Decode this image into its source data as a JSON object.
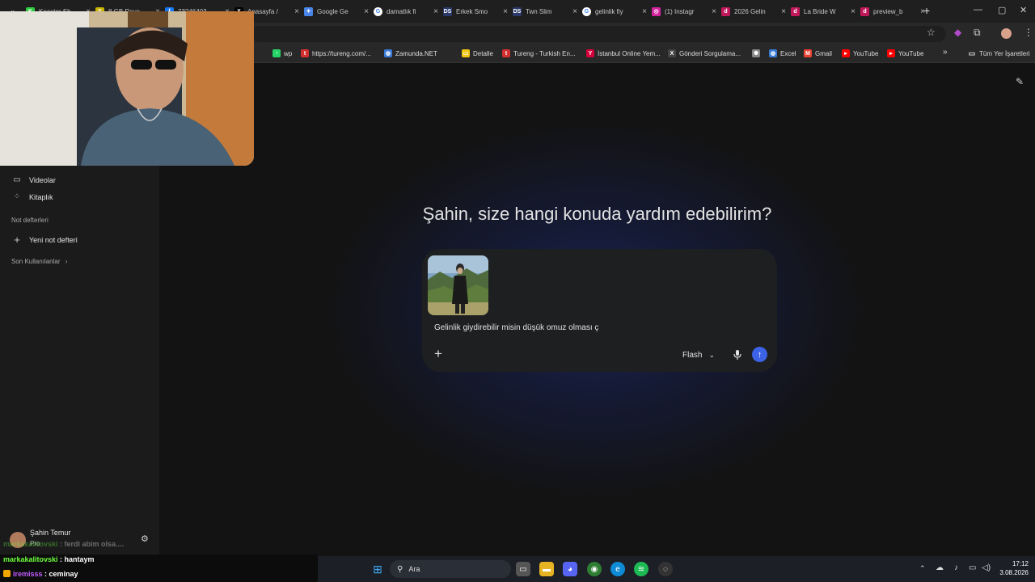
{
  "tabs": [
    {
      "title": "Keaxter Sh",
      "favicon": "K",
      "color": "#2ecc40"
    },
    {
      "title": "8 GB Reve",
      "favicon": "S",
      "color": "#c9b400"
    },
    {
      "title": "73246403",
      "favicon": "f",
      "color": "#1877f2"
    },
    {
      "title": "Anasayfa / ",
      "favicon": "X",
      "color": "#000000"
    },
    {
      "title": "Google Ge",
      "favicon": "✦",
      "color": "#4a86e8"
    },
    {
      "title": "damatlık fi",
      "favicon": "G",
      "color": "#ffffff"
    },
    {
      "title": "Erkek Smo",
      "favicon": "DS",
      "color": "#2b3a6b"
    },
    {
      "title": "Twn Slim ",
      "favicon": "DS",
      "color": "#2b3a6b"
    },
    {
      "title": "gelinlik fiy",
      "favicon": "G",
      "color": "#ffffff"
    },
    {
      "title": "(1) Instagr",
      "favicon": "◎",
      "color": "#d6249f"
    },
    {
      "title": "2026 Gelin",
      "favicon": "d",
      "color": "#c2185b"
    },
    {
      "title": "La Bride W",
      "favicon": "d",
      "color": "#c2185b"
    },
    {
      "title": "preview_b",
      "favicon": "d",
      "color": "#c2185b"
    }
  ],
  "bookmarks": [
    {
      "label": "wp",
      "icon": "whatsapp-icon",
      "color": "#25d366"
    },
    {
      "label": "https://tureng.com/...",
      "icon": "t",
      "color": "#d32f2f"
    },
    {
      "label": "Zamunda.NET",
      "icon": "globe",
      "color": "#3a7bd5"
    },
    {
      "label": "Detalle",
      "icon": "folder",
      "color": "#f1c40f"
    },
    {
      "label": "Tureng - Turkish En...",
      "icon": "t",
      "color": "#d32f2f"
    },
    {
      "label": "İstanbul Online Yem...",
      "icon": "Y",
      "color": "#d6003a"
    },
    {
      "label": "Gönderi Sorgulama...",
      "icon": "X",
      "color": "#444444"
    },
    {
      "label": "",
      "icon": "settings",
      "color": "#888888"
    },
    {
      "label": "Excel",
      "icon": "globe",
      "color": "#3a7bd5"
    },
    {
      "label": "Gmail",
      "icon": "M",
      "color": "#ea4335"
    },
    {
      "label": "YouTube",
      "icon": "yt",
      "color": "#ff0000"
    },
    {
      "label": "YouTube",
      "icon": "yt",
      "color": "#ff0000"
    }
  ],
  "bookmarks_more": "»",
  "all_bookmarks": "Tüm Yer İşaretleri",
  "sidebar": {
    "videos": "Videolar",
    "library": "Kitaplık",
    "notebooks_heading": "Not defterleri",
    "new_notebook": "Yeni not defteri",
    "recent": "Son Kullanılanlar",
    "recent_chevron": "›"
  },
  "account": {
    "name": "Şahin Temur",
    "plan": "Pro"
  },
  "main": {
    "greeting": "Şahin, size hangi konuda yardım edebilirim?",
    "prompt_text": "Gelinlik giydirebilir misin düşük omuz olması ç",
    "model_label": "Flash",
    "plus_symbol": "+",
    "send_symbol": "↑"
  },
  "chat": [
    {
      "user": "markakalitovski",
      "message": "ferdi abim olsa....",
      "faded": true
    },
    {
      "user": "markakalitovski",
      "message": "hantaym",
      "faded": false
    },
    {
      "user": "iremisss",
      "message": "ceminay",
      "faded": false
    }
  ],
  "taskbar": {
    "search_label": "Ara",
    "time": "17:12",
    "date": "3.08.2026"
  },
  "colors": {
    "accent": "#3c63e6",
    "background": "#131314",
    "sidebar": "#1b1b1c",
    "composer": "#1e1f20"
  }
}
